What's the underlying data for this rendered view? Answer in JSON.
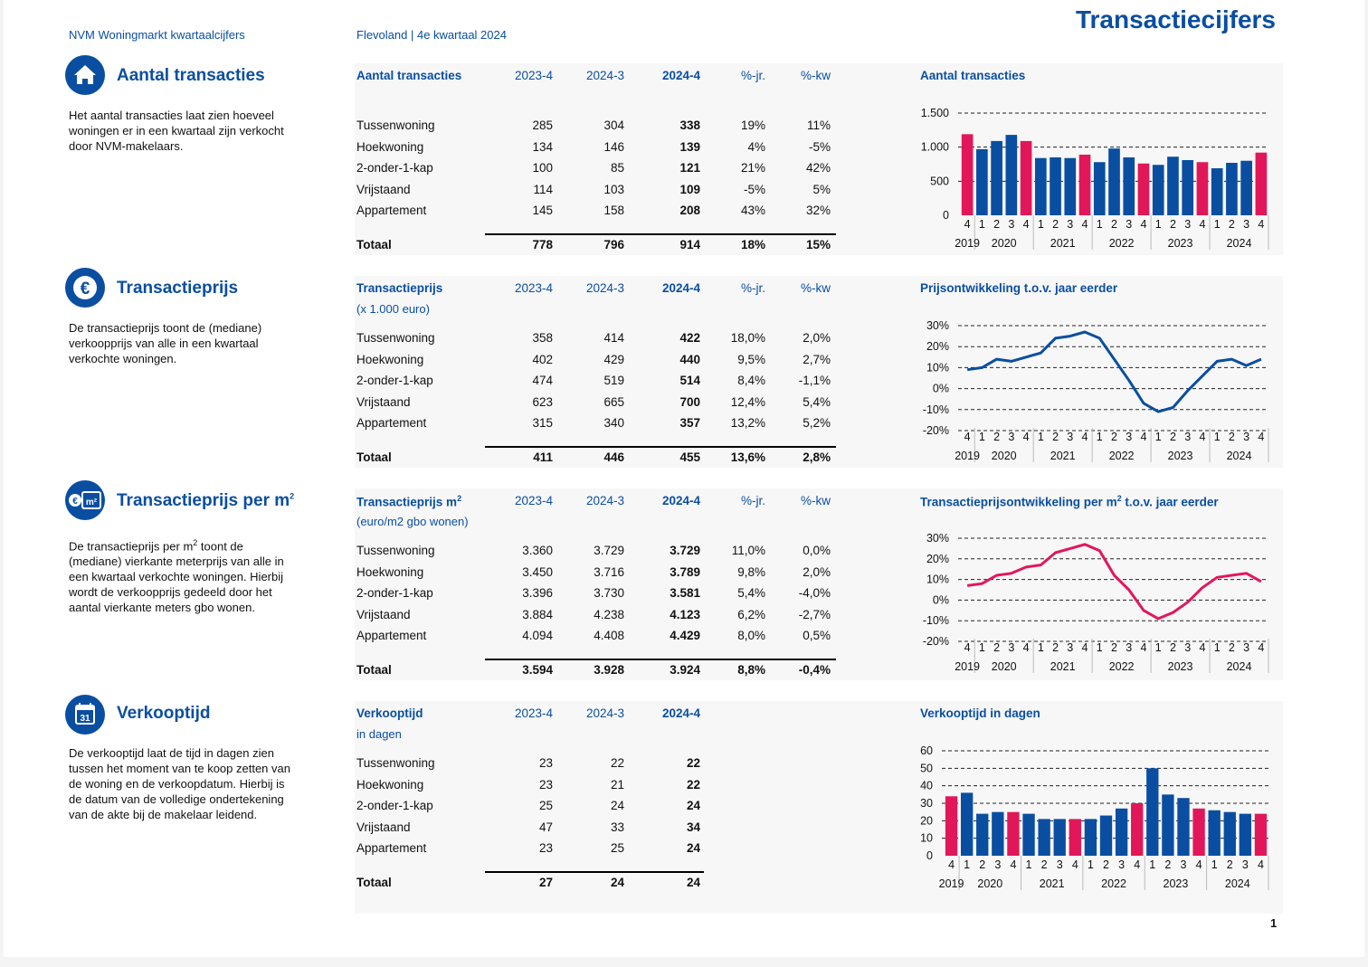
{
  "header": {
    "left": "NVM Woningmarkt kwartaalcijfers",
    "middle": "Flevoland | 4e kwartaal 2024",
    "title": "Transactiecijfers"
  },
  "page_number": "1",
  "colors": {
    "blue": "#0a4ea1",
    "pink": "#e2175a"
  },
  "sections": [
    {
      "title": "Aantal transacties",
      "icon": "house-icon",
      "description": "Het aantal transacties laat zien hoeveel woningen er in een kwartaal zijn verkocht door NVM-makelaars.",
      "table": {
        "title": "Aantal transacties",
        "subtitle": "",
        "headers": [
          "2023-4",
          "2024-3",
          "2024-4",
          "%-jr.",
          "%-kw"
        ],
        "rows": [
          [
            "Tussenwoning",
            "285",
            "304",
            "338",
            "19%",
            "11%"
          ],
          [
            "Hoekwoning",
            "134",
            "146",
            "139",
            "4%",
            "-5%"
          ],
          [
            "2-onder-1-kap",
            "100",
            "85",
            "121",
            "21%",
            "42%"
          ],
          [
            "Vrijstaand",
            "114",
            "103",
            "109",
            "-5%",
            "5%"
          ],
          [
            "Appartement",
            "145",
            "158",
            "208",
            "43%",
            "32%"
          ]
        ],
        "total": [
          "Totaal",
          "778",
          "796",
          "914",
          "18%",
          "15%"
        ]
      }
    },
    {
      "title": "Transactieprijs",
      "icon": "euro-icon",
      "description": "De transactieprijs toont de (mediane) verkoopprijs van alle in een kwartaal verkochte woningen.",
      "table": {
        "title": "Transactieprijs",
        "subtitle": "(x 1.000 euro)",
        "headers": [
          "2023-4",
          "2024-3",
          "2024-4",
          "%-jr.",
          "%-kw"
        ],
        "rows": [
          [
            "Tussenwoning",
            "358",
            "414",
            "422",
            "18,0%",
            "2,0%"
          ],
          [
            "Hoekwoning",
            "402",
            "429",
            "440",
            "9,5%",
            "2,7%"
          ],
          [
            "2-onder-1-kap",
            "474",
            "519",
            "514",
            "8,4%",
            "-1,1%"
          ],
          [
            "Vrijstaand",
            "623",
            "665",
            "700",
            "12,4%",
            "5,4%"
          ],
          [
            "Appartement",
            "315",
            "340",
            "357",
            "13,2%",
            "5,2%"
          ]
        ],
        "total": [
          "Totaal",
          "411",
          "446",
          "455",
          "13,6%",
          "2,8%"
        ]
      }
    },
    {
      "title": "Transactieprijs per m",
      "title_sup": "2",
      "icon": "euro-m2-icon",
      "icon_text": "m²",
      "description_parts": [
        "De transactieprijs per m",
        "2",
        " toont de (mediane) vierkante meterprijs van alle in een kwartaal verkochte woningen. Hierbij wordt de verkoopprijs gedeeld door het aantal vierkante meters gbo wonen."
      ],
      "table": {
        "title": "Transactieprijs m",
        "title_sup": "2",
        "subtitle": "(euro/m2 gbo wonen)",
        "headers": [
          "2023-4",
          "2024-3",
          "2024-4",
          "%-jr.",
          "%-kw"
        ],
        "rows": [
          [
            "Tussenwoning",
            "3.360",
            "3.729",
            "3.729",
            "11,0%",
            "0,0%"
          ],
          [
            "Hoekwoning",
            "3.450",
            "3.716",
            "3.789",
            "9,8%",
            "2,0%"
          ],
          [
            "2-onder-1-kap",
            "3.396",
            "3.730",
            "3.581",
            "5,4%",
            "-4,0%"
          ],
          [
            "Vrijstaand",
            "3.884",
            "4.238",
            "4.123",
            "6,2%",
            "-2,7%"
          ],
          [
            "Appartement",
            "4.094",
            "4.408",
            "4.429",
            "8,0%",
            "0,5%"
          ]
        ],
        "total": [
          "Totaal",
          "3.594",
          "3.928",
          "3.924",
          "8,8%",
          "-0,4%"
        ]
      }
    },
    {
      "title": "Verkooptijd",
      "icon": "calendar-icon",
      "icon_text": "31",
      "description": "De verkooptijd laat de tijd in dagen zien tussen het moment van te koop zetten van de woning en de verkoopdatum. Hierbij is de datum van de volledige ondertekening van de akte bij de makelaar leidend.",
      "table": {
        "title": "Verkooptijd",
        "subtitle": "in dagen",
        "headers": [
          "2023-4",
          "2024-3",
          "2024-4"
        ],
        "rows": [
          [
            "Tussenwoning",
            "23",
            "22",
            "22"
          ],
          [
            "Hoekwoning",
            "23",
            "21",
            "22"
          ],
          [
            "2-onder-1-kap",
            "25",
            "24",
            "24"
          ],
          [
            "Vrijstaand",
            "47",
            "33",
            "34"
          ],
          [
            "Appartement",
            "23",
            "25",
            "24"
          ]
        ],
        "total": [
          "Totaal",
          "27",
          "24",
          "24"
        ]
      }
    }
  ],
  "chart_data": [
    {
      "type": "bar",
      "title": "Aantal transacties",
      "categories": [
        "4",
        "1",
        "2",
        "3",
        "4",
        "1",
        "2",
        "3",
        "4",
        "1",
        "2",
        "3",
        "4",
        "1",
        "2",
        "3",
        "4",
        "1",
        "2",
        "3",
        "4"
      ],
      "year_labels": [
        "2019",
        "2020",
        "2021",
        "2022",
        "2023",
        "2024"
      ],
      "values": [
        1190,
        970,
        1090,
        1180,
        1090,
        840,
        850,
        840,
        890,
        780,
        980,
        850,
        760,
        740,
        860,
        810,
        780,
        690,
        770,
        800,
        920
      ],
      "highlight_color_indices": [
        0,
        4,
        8,
        12,
        16,
        20
      ],
      "yticks": [
        "0",
        "500",
        "1.000",
        "1.500"
      ],
      "ylim": [
        0,
        1500
      ]
    },
    {
      "type": "line",
      "title": "Prijsontwikkeling t.o.v. jaar eerder",
      "categories": [
        "4",
        "1",
        "2",
        "3",
        "4",
        "1",
        "2",
        "3",
        "4",
        "1",
        "2",
        "3",
        "4",
        "1",
        "2",
        "3",
        "4",
        "1",
        "2",
        "3",
        "4"
      ],
      "year_labels": [
        "2019",
        "2020",
        "2021",
        "2022",
        "2023",
        "2024"
      ],
      "values": [
        9,
        10,
        14,
        13,
        15,
        17,
        24,
        25,
        27,
        24,
        14,
        4,
        -7,
        -11,
        -9,
        -1,
        6,
        13,
        14,
        11,
        14
      ],
      "yticks": [
        "-20%",
        "-10%",
        "0%",
        "10%",
        "20%",
        "30%"
      ],
      "ylim": [
        -20,
        30
      ],
      "color": "#0a4ea1"
    },
    {
      "type": "line",
      "title": "Transactieprijsontwikkeling per m",
      "title_sup": "2",
      "title_suffix": " t.o.v. jaar eerder",
      "categories": [
        "4",
        "1",
        "2",
        "3",
        "4",
        "1",
        "2",
        "3",
        "4",
        "1",
        "2",
        "3",
        "4",
        "1",
        "2",
        "3",
        "4",
        "1",
        "2",
        "3",
        "4"
      ],
      "year_labels": [
        "2019",
        "2020",
        "2021",
        "2022",
        "2023",
        "2024"
      ],
      "values": [
        7,
        8,
        12,
        13,
        16,
        17,
        23,
        25,
        27,
        24,
        12,
        5,
        -5,
        -9,
        -6,
        -1,
        6,
        11,
        12,
        13,
        9
      ],
      "yticks": [
        "-20%",
        "-10%",
        "0%",
        "10%",
        "20%",
        "30%"
      ],
      "ylim": [
        -20,
        30
      ],
      "color": "#e2175a"
    },
    {
      "type": "bar",
      "title": "Verkooptijd in dagen",
      "categories": [
        "4",
        "1",
        "2",
        "3",
        "4",
        "1",
        "2",
        "3",
        "4",
        "1",
        "2",
        "3",
        "4",
        "1",
        "2",
        "3",
        "4",
        "1",
        "2",
        "3",
        "4"
      ],
      "year_labels": [
        "2019",
        "2020",
        "2021",
        "2022",
        "2023",
        "2024"
      ],
      "values": [
        34,
        36,
        24,
        25,
        25,
        24,
        21,
        21,
        21,
        21,
        23,
        27,
        30,
        50,
        35,
        33,
        27,
        26,
        25,
        24,
        24
      ],
      "highlight_color_indices": [
        0,
        4,
        8,
        12,
        16,
        20
      ],
      "yticks": [
        "0",
        "10",
        "20",
        "30",
        "40",
        "50",
        "60"
      ],
      "ylim": [
        0,
        60
      ]
    }
  ]
}
